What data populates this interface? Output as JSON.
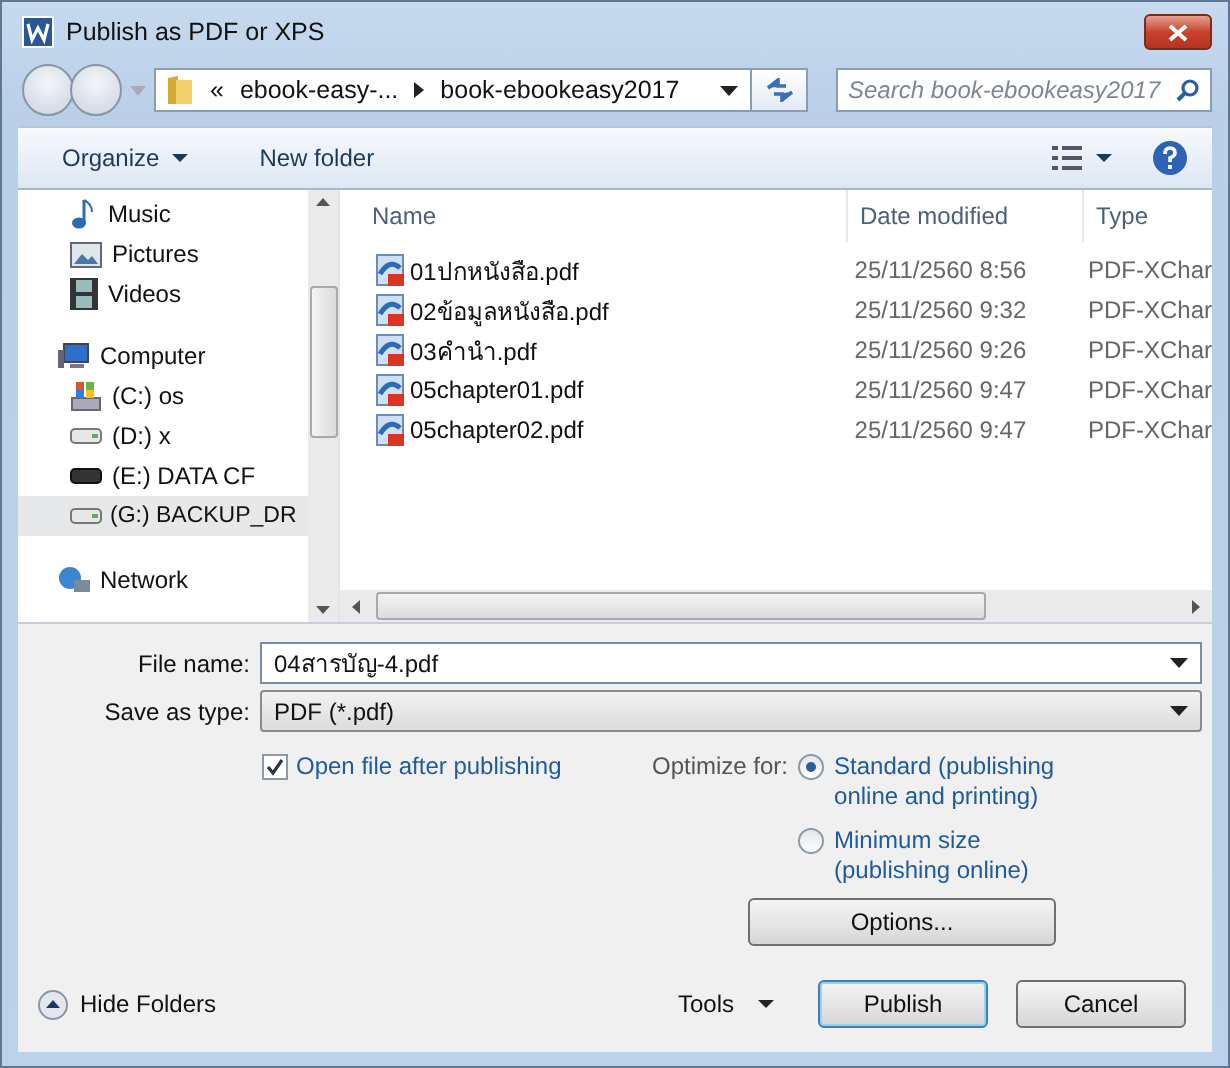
{
  "window": {
    "title": "Publish as PDF or XPS"
  },
  "address": {
    "overflow": "«",
    "breadcrumbs": [
      "ebook-easy-...",
      "book-ebookeasy2017"
    ]
  },
  "search": {
    "placeholder": "Search book-ebookeasy2017"
  },
  "toolbar": {
    "organize": "Organize",
    "new_folder": "New folder"
  },
  "nav": {
    "items": [
      {
        "label": "Music",
        "kind": "music",
        "selected": false
      },
      {
        "label": "Pictures",
        "kind": "pictures",
        "selected": false
      },
      {
        "label": "Videos",
        "kind": "videos",
        "selected": false
      },
      {
        "label": "Computer",
        "kind": "computer",
        "selected": false,
        "children": [
          {
            "label": "(C:) os",
            "kind": "system-drive",
            "selected": false
          },
          {
            "label": "(D:) x",
            "kind": "drive",
            "selected": false
          },
          {
            "label": "(E:) DATA CF",
            "kind": "dark-drive",
            "selected": false
          },
          {
            "label": "(G:) BACKUP_DR",
            "kind": "drive",
            "selected": true
          }
        ]
      },
      {
        "label": "Network",
        "kind": "network",
        "selected": false
      }
    ]
  },
  "table": {
    "columns": [
      "Name",
      "Date modified",
      "Type"
    ],
    "rows": [
      {
        "name": "01ปกหนังสือ.pdf",
        "date": "25/11/2560 8:56",
        "type": "PDF-XChar"
      },
      {
        "name": "02ข้อมูลหนังสือ.pdf",
        "date": "25/11/2560 9:32",
        "type": "PDF-XChar"
      },
      {
        "name": "03คำนำ.pdf",
        "date": "25/11/2560 9:26",
        "type": "PDF-XChar"
      },
      {
        "name": "05chapter01.pdf",
        "date": "25/11/2560 9:47",
        "type": "PDF-XChar"
      },
      {
        "name": "05chapter02.pdf",
        "date": "25/11/2560 9:47",
        "type": "PDF-XChar"
      }
    ]
  },
  "form": {
    "file_name": {
      "label": "File name:",
      "value": "04สารบัญ-4.pdf"
    },
    "save_type": {
      "label": "Save as type:",
      "value": "PDF (*.pdf)"
    },
    "open_after": {
      "label": "Open file after publishing",
      "checked": true
    },
    "optimize": {
      "label": "Optimize for:",
      "options": [
        {
          "label": "Standard (publishing online and printing)",
          "selected": true
        },
        {
          "label": "Minimum size (publishing online)",
          "selected": false
        }
      ]
    },
    "options_button": "Options..."
  },
  "footer": {
    "hide_folders": "Hide Folders",
    "tools": "Tools",
    "publish": "Publish",
    "cancel": "Cancel"
  }
}
